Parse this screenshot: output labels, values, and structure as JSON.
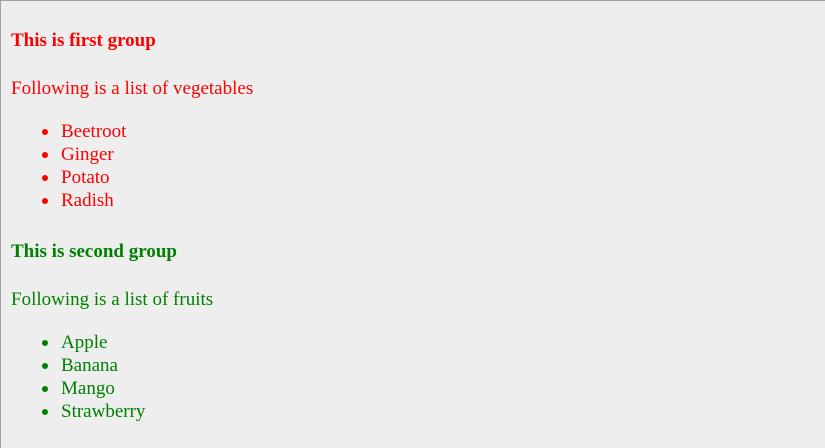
{
  "groups": [
    {
      "heading": "This is first group",
      "intro": "Following is a list of vegetables",
      "items": [
        "Beetroot",
        "Ginger",
        "Potato",
        "Radish"
      ],
      "color": "#ff0000"
    },
    {
      "heading": "This is second group",
      "intro": "Following is a list of fruits",
      "items": [
        "Apple",
        "Banana",
        "Mango",
        "Strawberry"
      ],
      "color": "#008000"
    }
  ]
}
